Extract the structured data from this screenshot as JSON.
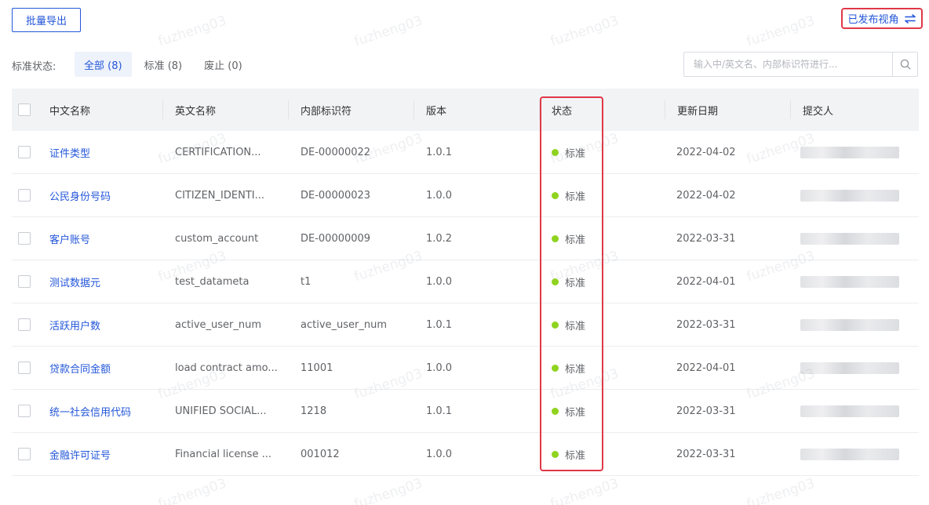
{
  "toolbar": {
    "export_label": "批量导出",
    "view_switch_label": "已发布视角",
    "view_switch_icon": "swap-arrows-icon"
  },
  "filters": {
    "label": "标准状态:",
    "tabs": [
      {
        "label": "全部 (8)",
        "active": true
      },
      {
        "label": "标准 (8)",
        "active": false
      },
      {
        "label": "废止 (0)",
        "active": false
      }
    ]
  },
  "search": {
    "placeholder": "输入中/英文名、内部标识符进行...",
    "icon": "search-icon"
  },
  "table": {
    "columns": [
      "中文名称",
      "英文名称",
      "内部标识符",
      "版本",
      "状态",
      "更新日期",
      "提交人"
    ],
    "rows": [
      {
        "cn": "证件类型",
        "en": "CERTIFICATION...",
        "id": "DE-00000022",
        "ver": "1.0.1",
        "status": "标准",
        "date": "2022-04-02"
      },
      {
        "cn": "公民身份号码",
        "en": "CITIZEN_IDENTI...",
        "id": "DE-00000023",
        "ver": "1.0.0",
        "status": "标准",
        "date": "2022-04-02"
      },
      {
        "cn": "客户账号",
        "en": "custom_account",
        "id": "DE-00000009",
        "ver": "1.0.2",
        "status": "标准",
        "date": "2022-03-31"
      },
      {
        "cn": "测试数据元",
        "en": "test_datameta",
        "id": "t1",
        "ver": "1.0.0",
        "status": "标准",
        "date": "2022-04-01"
      },
      {
        "cn": "活跃用户数",
        "en": "active_user_num",
        "id": "active_user_num",
        "ver": "1.0.1",
        "status": "标准",
        "date": "2022-03-31"
      },
      {
        "cn": "贷款合同金额",
        "en": "load contract amo...",
        "id": "11001",
        "ver": "1.0.0",
        "status": "标准",
        "date": "2022-04-01"
      },
      {
        "cn": "统一社会信用代码",
        "en": "UNIFIED SOCIAL...",
        "id": "1218",
        "ver": "1.0.1",
        "status": "标准",
        "date": "2022-03-31"
      },
      {
        "cn": "金融许可证号",
        "en": "Financial license ...",
        "id": "001012",
        "ver": "1.0.0",
        "status": "标准",
        "date": "2022-03-31"
      }
    ]
  },
  "watermark": "fuzheng03",
  "colors": {
    "accent": "#2356d9",
    "highlight": "#e03848",
    "status_ok": "#8fd31f"
  }
}
